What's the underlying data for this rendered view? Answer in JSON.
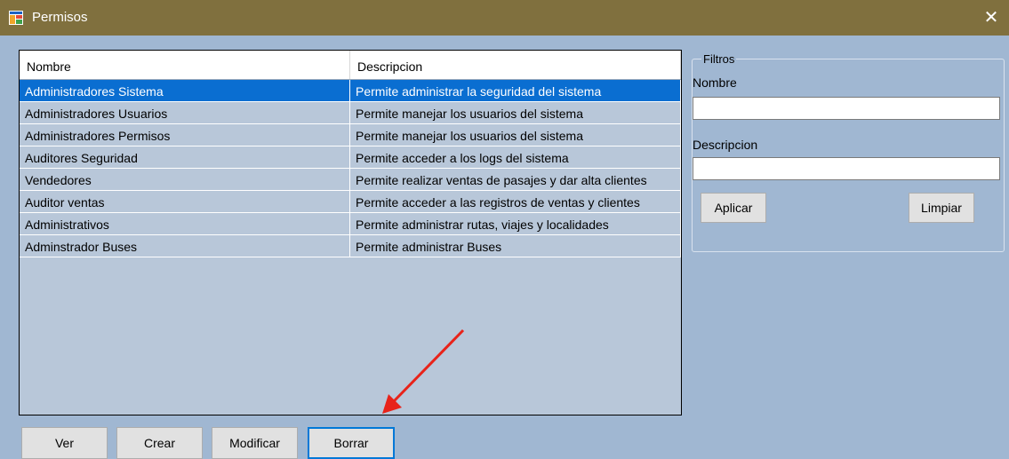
{
  "window": {
    "title": "Permisos",
    "close_symbol": "✕"
  },
  "grid": {
    "columns": [
      "Nombre",
      "Descripcion"
    ],
    "rows": [
      {
        "nombre": "Administradores Sistema",
        "descripcion": "Permite administrar la seguridad del sistema",
        "selected": true
      },
      {
        "nombre": "Administradores Usuarios",
        "descripcion": "Permite manejar los usuarios del sistema"
      },
      {
        "nombre": "Administradores Permisos",
        "descripcion": "Permite manejar los usuarios del sistema"
      },
      {
        "nombre": "Auditores Seguridad",
        "descripcion": "Permite acceder a los logs del sistema"
      },
      {
        "nombre": "Vendedores",
        "descripcion": "Permite realizar ventas de pasajes y dar alta clientes"
      },
      {
        "nombre": "Auditor ventas",
        "descripcion": "Permite acceder a las registros de ventas y clientes"
      },
      {
        "nombre": "Administrativos",
        "descripcion": "Permite administrar rutas, viajes y localidades"
      },
      {
        "nombre": "Adminstrador Buses",
        "descripcion": "Permite administrar Buses"
      }
    ]
  },
  "filters": {
    "legend": "Filtros",
    "nombre_label": "Nombre",
    "nombre_value": "",
    "descripcion_label": "Descripcion",
    "descripcion_value": "",
    "apply_label": "Aplicar",
    "clear_label": "Limpiar"
  },
  "actions": {
    "ver": "Ver",
    "crear": "Crear",
    "modificar": "Modificar",
    "borrar": "Borrar"
  },
  "colors": {
    "titlebar": "#80703e",
    "background": "#a0b7d2",
    "selection": "#0a6ed1",
    "arrow": "#e8231a"
  }
}
